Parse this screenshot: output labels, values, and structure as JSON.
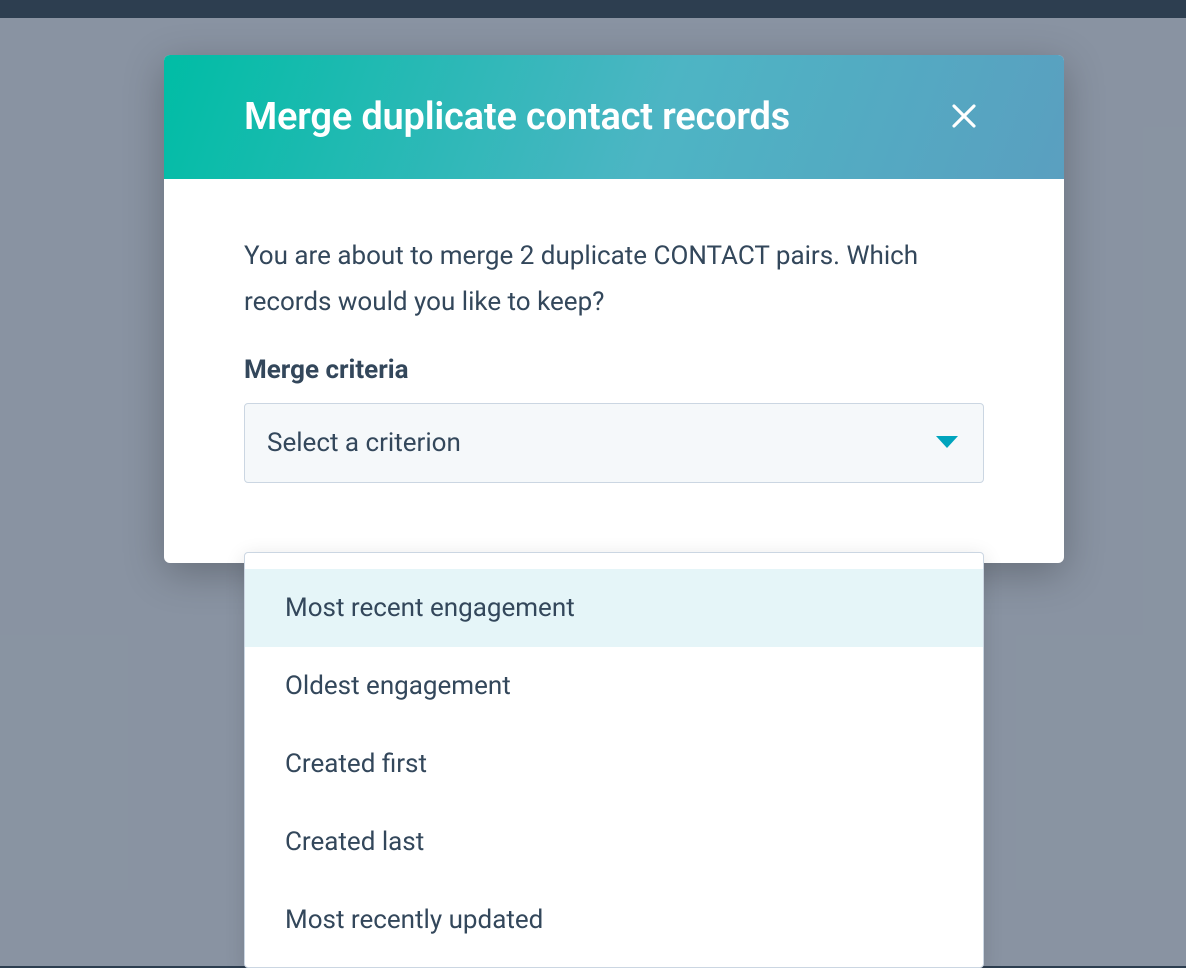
{
  "modal": {
    "title": "Merge duplicate contact records",
    "description": "You are about to merge 2 duplicate CONTACT pairs. Which records would you like to keep?",
    "field_label": "Merge criteria",
    "select_placeholder": "Select a criterion",
    "options": [
      "Most recent engagement",
      "Oldest engagement",
      "Created first",
      "Created last",
      "Most recently updated"
    ],
    "highlighted_index": 0
  }
}
